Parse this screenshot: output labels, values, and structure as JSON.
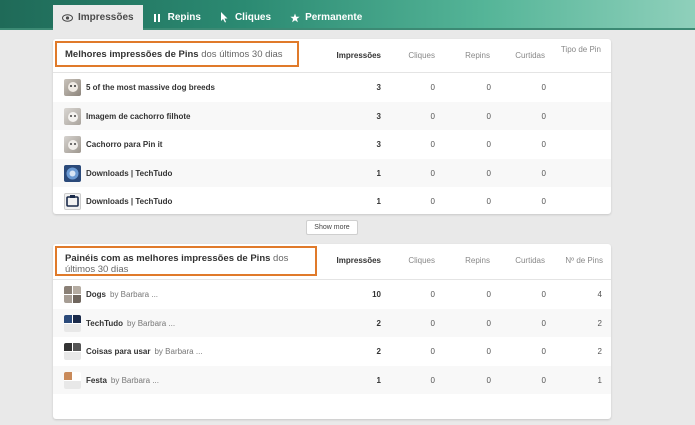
{
  "tabs": [
    {
      "label": "Impressões",
      "icon": "eye-icon"
    },
    {
      "label": "Repins",
      "icon": "repin-icon"
    },
    {
      "label": "Cliques",
      "icon": "cursor-icon"
    },
    {
      "label": "Permanente",
      "icon": "star-icon"
    }
  ],
  "top_pins": {
    "title_bold": "Melhores impressões de Pins",
    "title_rest": " dos últimos 30 dias",
    "columns": [
      "Impressões",
      "Cliques",
      "Repins",
      "Curtidas",
      "Tipo de Pin"
    ],
    "rows": [
      {
        "name": "5 of the most massive dog breeds",
        "impressions": "3",
        "clicks": "0",
        "repins": "0",
        "likes": "0"
      },
      {
        "name": "Imagem de cachorro filhote",
        "impressions": "3",
        "clicks": "0",
        "repins": "0",
        "likes": "0"
      },
      {
        "name": "Cachorro para Pin it",
        "impressions": "3",
        "clicks": "0",
        "repins": "0",
        "likes": "0"
      },
      {
        "name": "Downloads | TechTudo",
        "impressions": "1",
        "clicks": "0",
        "repins": "0",
        "likes": "0"
      },
      {
        "name": "Downloads | TechTudo",
        "impressions": "1",
        "clicks": "0",
        "repins": "0",
        "likes": "0"
      }
    ],
    "show_more": "Show more"
  },
  "top_boards": {
    "title_bold": "Painéis com as melhores impressões de Pins",
    "title_rest": " dos últimos 30 dias",
    "columns": [
      "Impressões",
      "Cliques",
      "Repins",
      "Curtidas",
      "Nº de Pins"
    ],
    "rows": [
      {
        "name": "Dogs",
        "by": "by Barbara ...",
        "impressions": "10",
        "clicks": "0",
        "repins": "0",
        "likes": "0",
        "pins": "4"
      },
      {
        "name": "TechTudo",
        "by": "by Barbara ...",
        "impressions": "2",
        "clicks": "0",
        "repins": "0",
        "likes": "0",
        "pins": "2"
      },
      {
        "name": "Coisas para usar",
        "by": "by Barbara ...",
        "impressions": "2",
        "clicks": "0",
        "repins": "0",
        "likes": "0",
        "pins": "2"
      },
      {
        "name": "Festa",
        "by": "by Barbara ...",
        "impressions": "1",
        "clicks": "0",
        "repins": "0",
        "likes": "0",
        "pins": "1"
      }
    ]
  },
  "colors": {
    "highlight_border": "#e07a2a",
    "header_gradient_start": "#1f6a58",
    "header_gradient_end": "#8fd0bb"
  }
}
